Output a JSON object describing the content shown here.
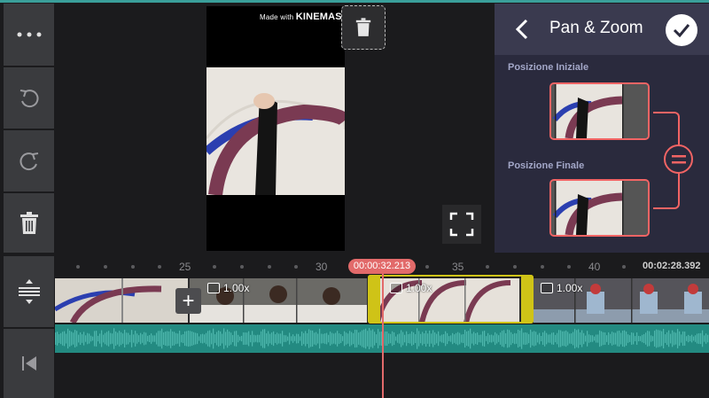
{
  "preview": {
    "watermark_small": "Made with",
    "watermark_brand": "KINEMASTER"
  },
  "panel": {
    "title": "Pan & Zoom",
    "start_label": "Posizione Iniziale",
    "end_label": "Posizione Finale"
  },
  "timeline": {
    "ticks": [
      "25",
      "30",
      "35",
      "40"
    ],
    "current_time": "00:00:32.213",
    "total_time": "00:02:28.392",
    "clips": [
      {
        "speed": "1.00x"
      },
      {
        "speed": "1.00x"
      },
      {
        "speed": "1.00x"
      }
    ]
  },
  "icons": {
    "menu": "more-horizontal-icon",
    "undo": "undo-icon",
    "redo": "redo-icon",
    "delete": "trash-icon",
    "back": "chevron-left-icon",
    "confirm": "check-icon",
    "link": "link-equal-icon",
    "fullscreen": "fullscreen-icon",
    "track_height": "expand-vertical-icon",
    "skip_start": "skip-to-start-icon",
    "add": "plus-icon"
  },
  "colors": {
    "accent": "#f26464",
    "selection": "#cfc317",
    "audio": "#238a81",
    "playhead": "#e26a6a"
  }
}
